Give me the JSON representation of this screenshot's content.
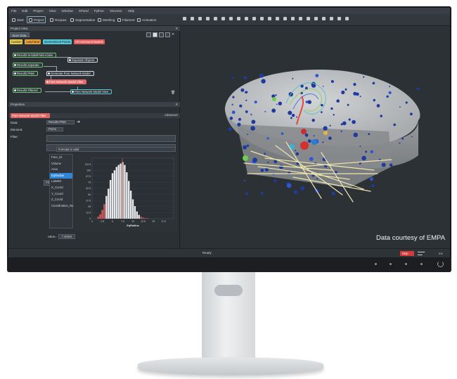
{
  "app": {
    "menu": [
      "File",
      "Edit",
      "Project",
      "View",
      "Window",
      "XPand",
      "Python",
      "XScreen",
      "Help"
    ],
    "toolbar": [
      {
        "label": "Start",
        "icon": "home-icon"
      },
      {
        "label": "Project",
        "icon": "project-icon",
        "active": true
      },
      {
        "label": "Recipes",
        "icon": "recipes-icon"
      },
      {
        "label": "Segmentation",
        "icon": "segmentation-icon"
      },
      {
        "label": "Meshing",
        "icon": "meshing-icon"
      },
      {
        "label": "Filament",
        "icon": "filament-icon"
      },
      {
        "label": "Animation",
        "icon": "animation-icon"
      }
    ]
  },
  "project_view": {
    "title": "Project View",
    "open_data": "Open Data...",
    "chips": [
      {
        "label": "Custom",
        "color": "#e7c94d"
      },
      {
        "label": "Load Mod",
        "color": "#e9a13a"
      },
      {
        "label": "Geometrized Points",
        "color": "#57c6d8"
      },
      {
        "label": "All Command Models",
        "color": "#e35d5d"
      }
    ],
    "nodes": [
      {
        "label": "Result2-to-labelField-4.labs",
        "style": "g"
      },
      {
        "label": "Separate Objects",
        "style": "w"
      },
      {
        "label": "Result2.separate",
        "style": "g"
      },
      {
        "label": "Generate Pore Network Model",
        "style": "w"
      },
      {
        "label": "Result2.PNM",
        "style": "g"
      },
      {
        "label": "Pore Network Model Filter",
        "style": "rf"
      },
      {
        "label": "Result2-Filtered",
        "style": "g"
      },
      {
        "label": "Pore Network Model View",
        "style": "cy"
      }
    ]
  },
  "properties": {
    "title": "Properties",
    "module": "Pore Network Model Filter",
    "advanced": "Advanced",
    "data_label": "Data:",
    "data_value": "Result2.PNM",
    "element_label": "Element:",
    "element_value": "Pores",
    "filter_label": "Filter:",
    "formula": "Formula is valid",
    "filter_button": "Filter",
    "attributes": [
      "Pore_ID",
      "Volume",
      "Area",
      "EqRadius",
      "LabelID",
      "X_Coord",
      "Y_Coord",
      "Z_Coord",
      "Coordination_Nu"
    ],
    "selected_attribute": "EqRadius",
    "value_label": "value=",
    "value": "7.40944",
    "auto_refresh": "auto-refresh",
    "apply": "Apply"
  },
  "chart_data": {
    "type": "bar",
    "x": [
      1.5,
      2.0,
      2.5,
      3.0,
      3.5,
      4.0,
      4.5,
      5.0,
      5.5,
      6.0,
      6.5,
      7.0,
      7.5,
      8.0,
      8.5,
      9.0,
      9.5,
      10.0,
      10.5,
      11.0,
      11.5,
      12.0,
      12.5,
      13.0,
      13.5,
      14.0
    ],
    "values": [
      4,
      9,
      18,
      30,
      47,
      62,
      80,
      94,
      100,
      107,
      111,
      114,
      117,
      111,
      96,
      78,
      58,
      40,
      26,
      15,
      8,
      4,
      2,
      1,
      1,
      0
    ],
    "xlabel": "EqRadius",
    "ylabel": "",
    "xlim": [
      0,
      20
    ],
    "ylim": [
      0,
      125
    ],
    "xticks": [
      "0",
      "2.5",
      "5",
      "7.5",
      "10",
      "12.5",
      "15",
      "17.5"
    ],
    "yticks": [
      "0",
      "12.5",
      "25",
      "37.5",
      "50",
      "62.5",
      "75",
      "87.5",
      "100",
      "112.5"
    ],
    "marker_value": 7.40944
  },
  "viewer": {
    "courtesy": "Data courtesy of EMPA"
  },
  "status": {
    "ready": "Ready",
    "stop": "Stop",
    "percent": "0%"
  },
  "colors": {
    "accent": "#2f86d6",
    "stop": "#d53b3b",
    "apply": "#46b34a",
    "filter_tag": "#e06464"
  }
}
